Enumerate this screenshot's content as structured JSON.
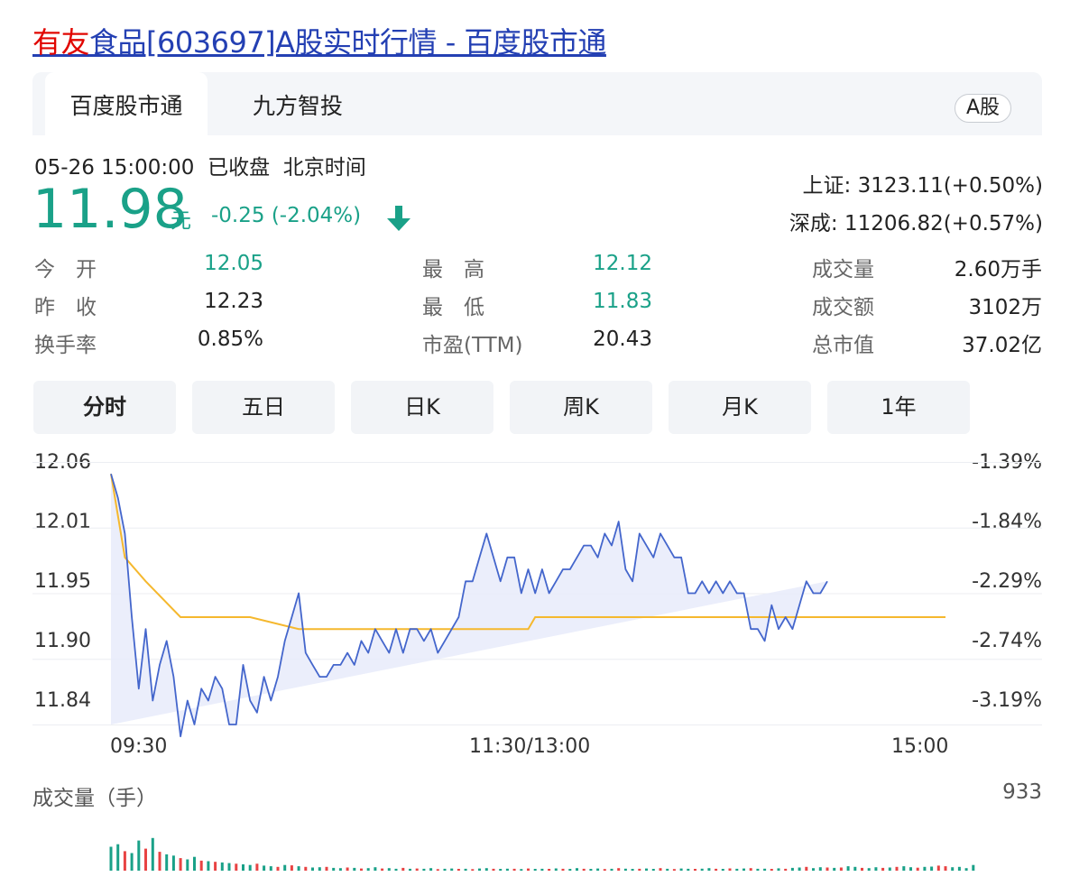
{
  "header": {
    "title_highlight": "有友",
    "title_rest": "食品[603697]A股实时行情 - 百度股市通"
  },
  "tabs": [
    {
      "label": "百度股市通",
      "active": true
    },
    {
      "label": "九方智投",
      "active": false
    }
  ],
  "market_tag": "A股",
  "quote": {
    "datetime": "05-26 15:00:00",
    "status": "已收盘",
    "timezone": "北京时间",
    "price": "11.98",
    "unit": "元",
    "change": "-0.25 (-2.04%)",
    "direction": "down"
  },
  "indices": [
    {
      "name": "上证:",
      "value": "3123.11(+0.50%)"
    },
    {
      "name": "深成:",
      "value": "11206.82(+0.57%)"
    }
  ],
  "stats": [
    {
      "label": "今　开",
      "value": "12.05",
      "color": "green"
    },
    {
      "label": "昨　收",
      "value": "12.23",
      "color": "dark"
    },
    {
      "label": "换手率",
      "value": "0.85%",
      "color": "dark"
    },
    {
      "label": "最　高",
      "value": "12.12",
      "color": "green"
    },
    {
      "label": "最　低",
      "value": "11.83",
      "color": "green"
    },
    {
      "label": "市盈(TTM)",
      "value": "20.43",
      "color": "dark"
    },
    {
      "label": "成交量",
      "value": "2.60万手",
      "color": "dark"
    },
    {
      "label": "成交额",
      "value": "3102万",
      "color": "dark"
    },
    {
      "label": "总市值",
      "value": "37.02亿",
      "color": "dark"
    }
  ],
  "periods": [
    {
      "label": "分时",
      "active": true
    },
    {
      "label": "五日",
      "active": false
    },
    {
      "label": "日K",
      "active": false
    },
    {
      "label": "周K",
      "active": false
    },
    {
      "label": "月K",
      "active": false
    },
    {
      "label": "1年",
      "active": false
    }
  ],
  "colors": {
    "up": "#e84343",
    "down": "#1aa188",
    "price_line": "#4466cc",
    "avg_line": "#f5b82e",
    "area_fill": "#e7ebfa"
  },
  "chart_data": {
    "type": "line",
    "y_ticks": [
      "12.06",
      "12.01",
      "11.95",
      "11.90",
      "11.84"
    ],
    "y_pct_ticks": [
      "-1.39%",
      "-1.84%",
      "-2.29%",
      "-2.74%",
      "-3.19%"
    ],
    "ylim": [
      11.84,
      12.06
    ],
    "x_ticks": [
      "09:30",
      "11:30/13:00",
      "15:00"
    ],
    "session_minutes": 240,
    "series": [
      {
        "key": "price",
        "t": [
          0,
          2,
          4,
          6,
          8,
          10,
          12,
          14,
          16,
          18,
          20,
          22,
          24,
          26,
          28,
          30,
          32,
          34,
          36,
          38,
          40,
          42,
          44,
          46,
          48,
          50,
          52,
          54,
          56,
          58,
          60,
          62,
          64,
          66,
          68,
          70,
          72,
          74,
          76,
          78,
          80,
          82,
          84,
          86,
          88,
          90,
          92,
          94,
          96,
          98,
          100,
          102,
          104,
          106,
          108,
          110,
          112,
          114,
          116,
          118,
          120,
          122,
          124,
          126,
          128,
          130,
          132,
          134,
          136,
          138,
          140,
          142,
          144,
          146,
          148,
          150,
          152,
          154,
          156,
          158,
          160,
          162,
          164,
          166,
          168,
          170,
          172,
          174,
          176,
          178,
          180,
          182,
          184,
          186,
          188,
          190,
          192,
          194,
          196,
          198,
          200,
          202,
          204,
          206,
          208,
          210,
          212,
          214,
          216,
          218,
          220,
          222,
          224,
          226,
          228,
          230,
          232,
          234,
          236,
          238,
          240
        ],
        "values": [
          12.05,
          12.03,
          12.0,
          11.93,
          11.87,
          11.92,
          11.86,
          11.89,
          11.91,
          11.88,
          11.83,
          11.86,
          11.84,
          11.87,
          11.86,
          11.88,
          11.87,
          11.84,
          11.84,
          11.89,
          11.86,
          11.85,
          11.88,
          11.86,
          11.88,
          11.91,
          11.93,
          11.95,
          11.9,
          11.89,
          11.88,
          11.88,
          11.89,
          11.89,
          11.9,
          11.89,
          11.91,
          11.9,
          11.92,
          11.91,
          11.9,
          11.92,
          11.9,
          11.92,
          11.92,
          11.91,
          11.92,
          11.9,
          11.91,
          11.92,
          11.93,
          11.96,
          11.96,
          11.98,
          12.0,
          11.98,
          11.96,
          11.98,
          11.98,
          11.95,
          11.97,
          11.95,
          11.97,
          11.95,
          11.96,
          11.97,
          11.97,
          11.98,
          11.99,
          11.99,
          11.98,
          12.0,
          11.99,
          12.01,
          11.97,
          11.96,
          12.0,
          11.99,
          11.98,
          12.0,
          11.99,
          11.98,
          11.98,
          11.95,
          11.95,
          11.96,
          11.95,
          11.96,
          11.95,
          11.96,
          11.95,
          11.95,
          11.92,
          11.92,
          11.91,
          11.94,
          11.92,
          11.93,
          11.92,
          11.94,
          11.96,
          11.95,
          11.95,
          11.96
        ],
        "area": true
      },
      {
        "key": "avg",
        "t": [
          0,
          4,
          10,
          20,
          28,
          40,
          54,
          60,
          90,
          96,
          120,
          122,
          154,
          160,
          176,
          186,
          198,
          210,
          220,
          224,
          228,
          232,
          236,
          240
        ],
        "values": [
          12.05,
          11.98,
          11.96,
          11.93,
          11.93,
          11.93,
          11.92,
          11.92,
          11.92,
          11.92,
          11.92,
          11.93,
          11.93,
          11.93,
          11.93,
          11.93,
          11.93,
          11.93,
          11.93,
          11.93,
          11.93,
          11.93,
          11.93,
          11.93
        ]
      }
    ],
    "volume": {
      "title": "成交量（手）",
      "max_label": "933",
      "max": 933,
      "t_step": 2,
      "values": [
        380,
        420,
        310,
        280,
        480,
        350,
        520,
        300,
        260,
        240,
        200,
        180,
        220,
        160,
        150,
        140,
        130,
        120,
        110,
        100,
        90,
        110,
        80,
        70,
        60,
        90,
        85,
        70,
        60,
        50,
        55,
        60,
        45,
        40,
        50,
        45,
        35,
        40,
        55,
        35,
        40,
        30,
        45,
        30,
        35,
        30,
        40,
        25,
        30,
        35,
        28,
        30,
        25,
        35,
        40,
        30,
        28,
        32,
        30,
        26,
        34,
        28,
        30,
        28,
        36,
        30,
        28,
        40,
        30,
        28,
        35,
        26,
        30,
        40,
        32,
        28,
        30,
        35,
        28,
        40,
        30,
        26,
        35,
        30,
        28,
        32,
        40,
        30,
        28,
        36,
        30,
        34,
        40,
        30,
        32,
        28,
        38,
        30,
        45,
        50,
        60,
        40,
        55,
        50,
        45,
        50,
        70,
        60,
        45,
        40,
        55,
        45,
        50,
        60,
        70,
        55,
        48,
        60,
        65,
        80,
        70,
        55,
        60,
        40,
        90
      ],
      "colors": [
        "down",
        "down",
        "up",
        "down",
        "down",
        "up",
        "down",
        "up",
        "down",
        "down",
        "up",
        "down",
        "down",
        "up",
        "down",
        "up",
        "down",
        "down",
        "up",
        "down",
        "down",
        "up",
        "down",
        "down",
        "up",
        "down",
        "up",
        "down",
        "up",
        "down",
        "down",
        "up",
        "down",
        "down",
        "up",
        "down",
        "up",
        "down",
        "down",
        "up",
        "down",
        "down",
        "up",
        "down",
        "up",
        "down",
        "down",
        "up",
        "down",
        "down",
        "up",
        "down",
        "up",
        "down",
        "down",
        "up",
        "down",
        "down",
        "up",
        "down",
        "up",
        "down",
        "down",
        "up",
        "down",
        "up",
        "down",
        "down",
        "up",
        "down",
        "down",
        "up",
        "down",
        "up",
        "down",
        "down",
        "up",
        "down",
        "down",
        "up",
        "down",
        "up",
        "down",
        "down",
        "up",
        "down",
        "down",
        "up",
        "down",
        "up",
        "down",
        "down",
        "up",
        "down",
        "down",
        "up",
        "down",
        "up",
        "down",
        "down",
        "up",
        "down",
        "down",
        "up",
        "down",
        "up",
        "down",
        "down",
        "up",
        "down",
        "down",
        "up",
        "down",
        "up",
        "down",
        "down",
        "up",
        "down",
        "down",
        "up",
        "up"
      ]
    }
  }
}
